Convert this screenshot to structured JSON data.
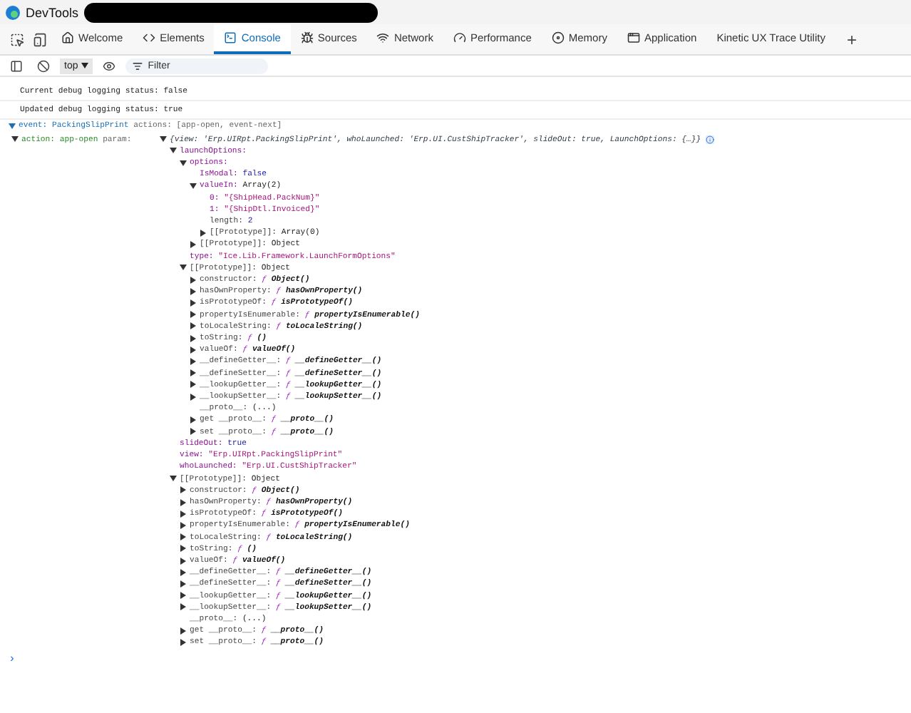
{
  "window": {
    "title": "DevTools"
  },
  "tabs": [
    {
      "label": "Welcome",
      "selected": false
    },
    {
      "label": "Elements",
      "selected": false
    },
    {
      "label": "Console",
      "selected": true
    },
    {
      "label": "Sources",
      "selected": false
    },
    {
      "label": "Network",
      "selected": false
    },
    {
      "label": "Performance",
      "selected": false
    },
    {
      "label": "Memory",
      "selected": false
    },
    {
      "label": "Application",
      "selected": false
    },
    {
      "label": "Kinetic UX Trace Utility",
      "selected": false
    }
  ],
  "add_tab": "+",
  "toolbar": {
    "context": "top",
    "filter_placeholder": "Filter"
  },
  "messages": [
    {
      "kind": "log",
      "text": "Current debug logging status: false"
    },
    {
      "kind": "log",
      "text": "Updated debug logging status: true"
    },
    {
      "kind": "event",
      "expanded": true,
      "label": "event:",
      "name": "PackingSlipPrint",
      "actions": "actions: [app-open, event-next]"
    }
  ],
  "action": {
    "expanded": true,
    "label": "action: app-open",
    "param_label": "param:",
    "tree": {
      "value": "{view: 'Erp.UIRpt.PackingSlipPrint', whoLaunched: 'Erp.UI.CustShipTracker', slideOut: true, LaunchOptions: {…}}",
      "kind": "preview",
      "expanded": true,
      "children": [
        {
          "key": "launchOptions:",
          "own": true,
          "kind": "plain",
          "expanded": true,
          "children": [
            {
              "key": "options:",
              "own": true,
              "kind": "plain",
              "expanded": true,
              "children": [
                {
                  "key": "IsModal:",
                  "own": true,
                  "value": "false",
                  "kind": "keyword"
                },
                {
                  "key": "valueIn:",
                  "own": true,
                  "value": "Array(2)",
                  "kind": "plain",
                  "expanded": true,
                  "children": [
                    {
                      "key": "0:",
                      "own": true,
                      "value": "\"{ShipHead.PackNum}\"",
                      "kind": "string"
                    },
                    {
                      "key": "1:",
                      "own": true,
                      "value": "\"{ShipDtl.Invoiced}\"",
                      "kind": "string"
                    },
                    {
                      "key": "length:",
                      "own": false,
                      "value": "2",
                      "kind": "keyword"
                    },
                    {
                      "key": "[[Prototype]]:",
                      "own": false,
                      "value": "Array(0)",
                      "kind": "plain",
                      "expanded": false
                    }
                  ]
                },
                {
                  "key": "[[Prototype]]:",
                  "own": false,
                  "value": "Object",
                  "kind": "plain",
                  "expanded": false
                }
              ]
            },
            {
              "key": "type:",
              "own": true,
              "value": "\"Ice.Lib.Framework.LaunchFormOptions\"",
              "kind": "string"
            },
            {
              "key": "[[Prototype]]:",
              "own": false,
              "value": "Object",
              "kind": "plain",
              "expanded": true,
              "children": [
                {
                  "key": "constructor:",
                  "own": false,
                  "sign": "ƒ",
                  "value": "Object()",
                  "kind": "function",
                  "expanded": false
                },
                {
                  "key": "hasOwnProperty:",
                  "own": false,
                  "sign": "ƒ",
                  "value": "hasOwnProperty()",
                  "kind": "function",
                  "expanded": false
                },
                {
                  "key": "isPrototypeOf:",
                  "own": false,
                  "sign": "ƒ",
                  "value": "isPrototypeOf()",
                  "kind": "function",
                  "expanded": false
                },
                {
                  "key": "propertyIsEnumerable:",
                  "own": false,
                  "sign": "ƒ",
                  "value": "propertyIsEnumerable()",
                  "kind": "function",
                  "expanded": false
                },
                {
                  "key": "toLocaleString:",
                  "own": false,
                  "sign": "ƒ",
                  "value": "toLocaleString()",
                  "kind": "function",
                  "expanded": false
                },
                {
                  "key": "toString:",
                  "own": false,
                  "sign": "ƒ",
                  "value": "()",
                  "kind": "function",
                  "expanded": false
                },
                {
                  "key": "valueOf:",
                  "own": false,
                  "sign": "ƒ",
                  "value": "valueOf()",
                  "kind": "function",
                  "expanded": false
                },
                {
                  "key": "__defineGetter__:",
                  "own": false,
                  "sign": "ƒ",
                  "value": "__defineGetter__()",
                  "kind": "function",
                  "expanded": false
                },
                {
                  "key": "__defineSetter__:",
                  "own": false,
                  "sign": "ƒ",
                  "value": "__defineSetter__()",
                  "kind": "function",
                  "expanded": false
                },
                {
                  "key": "__lookupGetter__:",
                  "own": false,
                  "sign": "ƒ",
                  "value": "__lookupGetter__()",
                  "kind": "function",
                  "expanded": false
                },
                {
                  "key": "__lookupSetter__:",
                  "own": false,
                  "sign": "ƒ",
                  "value": "__lookupSetter__()",
                  "kind": "function",
                  "expanded": false
                },
                {
                  "key": "__proto__:",
                  "own": false,
                  "value": "(...)",
                  "kind": "plain"
                },
                {
                  "key": "get __proto__:",
                  "own": false,
                  "sign": "ƒ",
                  "value": "__proto__()",
                  "kind": "function",
                  "expanded": false
                },
                {
                  "key": "set __proto__:",
                  "own": false,
                  "sign": "ƒ",
                  "value": "__proto__()",
                  "kind": "function",
                  "expanded": false
                }
              ]
            }
          ]
        },
        {
          "key": "slideOut:",
          "own": true,
          "value": "true",
          "kind": "keyword"
        },
        {
          "key": "view:",
          "own": true,
          "value": "\"Erp.UIRpt.PackingSlipPrint\"",
          "kind": "string"
        },
        {
          "key": "whoLaunched:",
          "own": true,
          "value": "\"Erp.UI.CustShipTracker\"",
          "kind": "string"
        },
        {
          "key": "[[Prototype]]:",
          "own": false,
          "value": "Object",
          "kind": "plain",
          "expanded": true,
          "children": [
            {
              "key": "constructor:",
              "own": false,
              "sign": "ƒ",
              "value": "Object()",
              "kind": "function",
              "expanded": false
            },
            {
              "key": "hasOwnProperty:",
              "own": false,
              "sign": "ƒ",
              "value": "hasOwnProperty()",
              "kind": "function",
              "expanded": false
            },
            {
              "key": "isPrototypeOf:",
              "own": false,
              "sign": "ƒ",
              "value": "isPrototypeOf()",
              "kind": "function",
              "expanded": false
            },
            {
              "key": "propertyIsEnumerable:",
              "own": false,
              "sign": "ƒ",
              "value": "propertyIsEnumerable()",
              "kind": "function",
              "expanded": false
            },
            {
              "key": "toLocaleString:",
              "own": false,
              "sign": "ƒ",
              "value": "toLocaleString()",
              "kind": "function",
              "expanded": false
            },
            {
              "key": "toString:",
              "own": false,
              "sign": "ƒ",
              "value": "()",
              "kind": "function",
              "expanded": false
            },
            {
              "key": "valueOf:",
              "own": false,
              "sign": "ƒ",
              "value": "valueOf()",
              "kind": "function",
              "expanded": false
            },
            {
              "key": "__defineGetter__:",
              "own": false,
              "sign": "ƒ",
              "value": "__defineGetter__()",
              "kind": "function",
              "expanded": false
            },
            {
              "key": "__defineSetter__:",
              "own": false,
              "sign": "ƒ",
              "value": "__defineSetter__()",
              "kind": "function",
              "expanded": false
            },
            {
              "key": "__lookupGetter__:",
              "own": false,
              "sign": "ƒ",
              "value": "__lookupGetter__()",
              "kind": "function",
              "expanded": false
            },
            {
              "key": "__lookupSetter__:",
              "own": false,
              "sign": "ƒ",
              "value": "__lookupSetter__()",
              "kind": "function",
              "expanded": false
            },
            {
              "key": "__proto__:",
              "own": false,
              "value": "(...)",
              "kind": "plain"
            },
            {
              "key": "get __proto__:",
              "own": false,
              "sign": "ƒ",
              "value": "__proto__()",
              "kind": "function",
              "expanded": false
            },
            {
              "key": "set __proto__:",
              "own": false,
              "sign": "ƒ",
              "value": "__proto__()",
              "kind": "function",
              "expanded": false
            }
          ]
        }
      ]
    }
  },
  "prompt": "›"
}
